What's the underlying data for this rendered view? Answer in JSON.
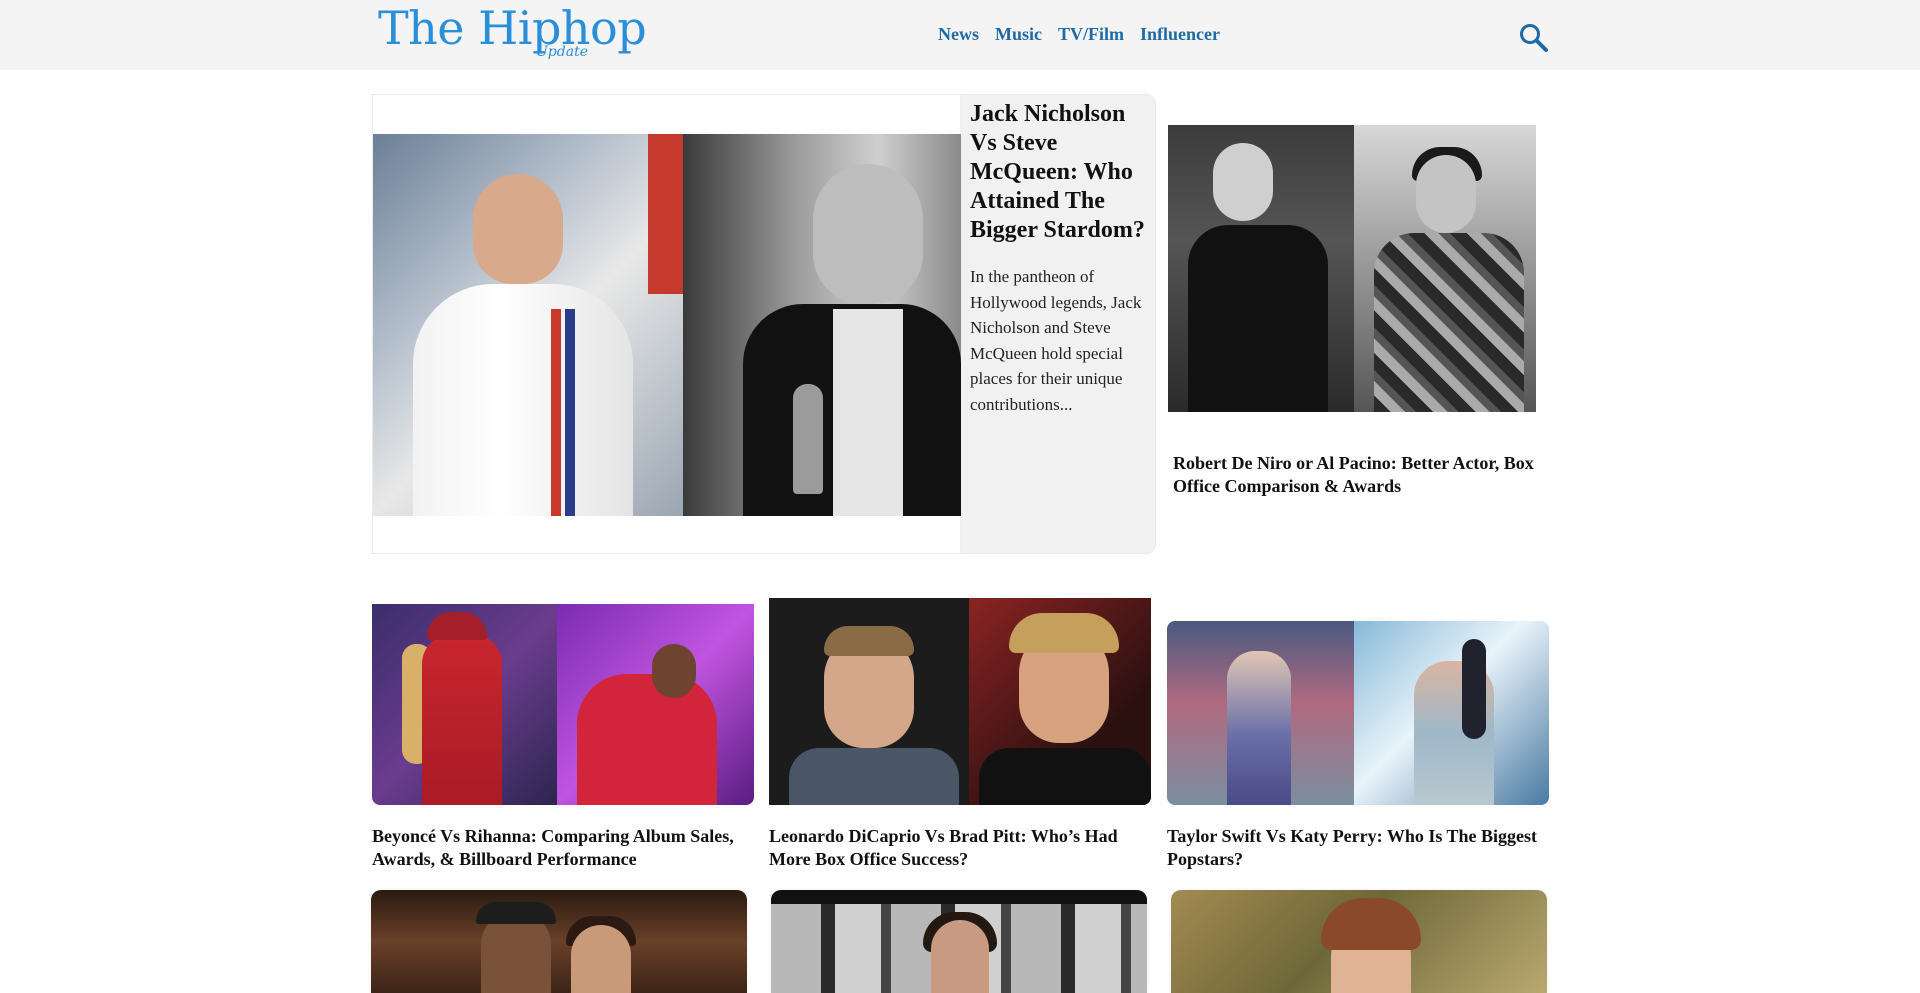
{
  "header": {
    "logo_main": "The Hiphop",
    "logo_sub": "Update",
    "nav": [
      "News",
      "Music",
      "TV/Film",
      "Influencer"
    ],
    "search_icon": "search-icon",
    "brand_color": "#2a8ed8",
    "nav_color": "#1f6aa5"
  },
  "featured": {
    "title": "Jack Nicholson Vs Steve McQueen: Who Attained The Bigger Stardom?",
    "excerpt": "In the pantheon of Hollywood legends, Jack Nicholson and Steve McQueen hold special places for their unique contributions..."
  },
  "side_article": {
    "title": "Robert De Niro or Al Pacino: Better Actor, Box Office Comparison & Awards"
  },
  "grid": [
    {
      "title": "Beyoncé Vs Rihanna: Comparing Album Sales, Awards, & Billboard Performance"
    },
    {
      "title": "Leonardo DiCaprio Vs Brad Pitt: Who’s Had More Box Office Success?"
    },
    {
      "title": "Taylor Swift Vs Katy Perry: Who Is The Biggest Popstars?"
    }
  ]
}
